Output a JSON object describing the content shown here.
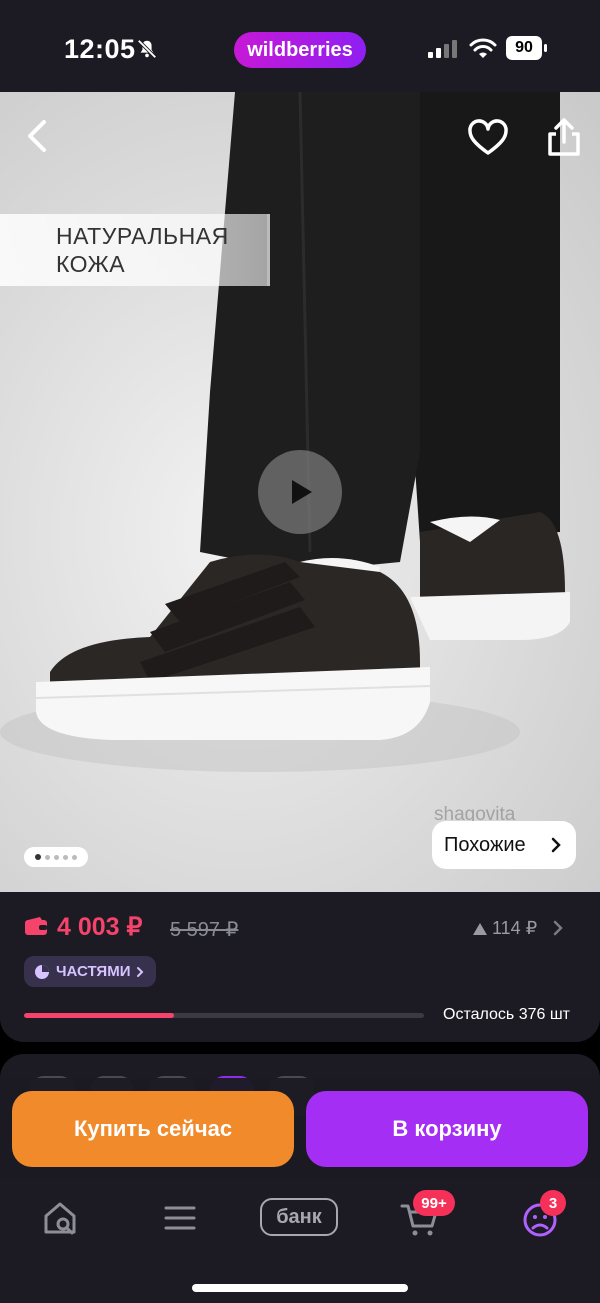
{
  "status_bar": {
    "time": "12:05",
    "brand": "wildberries",
    "battery": "90"
  },
  "hero": {
    "badge_line1": "НАТУРАЛЬНАЯ",
    "badge_line2": "КОЖА",
    "watermark": "shagovita",
    "similar_label": "Похожие",
    "gallery_total": 5,
    "gallery_current": 1
  },
  "price": {
    "current": "4 003 ₽",
    "old": "5 597 ₽",
    "diff": "114 ₽",
    "installments_label": "ЧАСТЯМИ",
    "stock_fraction": 0.375,
    "remaining_label": "Осталось 376 шт"
  },
  "actions": {
    "buy_now": "Купить сейчас",
    "add_to_cart": "В корзину"
  },
  "bottom_nav": {
    "bank_label": "банк",
    "cart_badge": "99+",
    "profile_badge": "3"
  },
  "colors": {
    "accent_price": "#f5436b",
    "buy_now": "#f08a2b",
    "add_to_cart": "#a52ef5",
    "brand_gradient_start": "#c619d6",
    "brand_gradient_end": "#8f1ff2"
  }
}
